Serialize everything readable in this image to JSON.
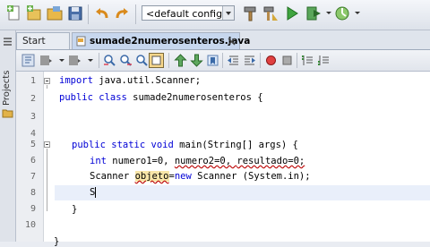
{
  "toolbar": {
    "config_value": "<default config>"
  },
  "sidebar": {
    "projects_label": "Projects"
  },
  "tabs": [
    {
      "label": "Start Page"
    },
    {
      "label": "sumade2numerosenteros.java"
    }
  ],
  "editor": {
    "line_numbers": [
      "1",
      "2",
      "3",
      "4",
      "5",
      "6",
      "7",
      "8",
      "9",
      "10"
    ],
    "lines": {
      "l1_kw": "import",
      "l1_rest": " java.util.Scanner;",
      "l2_kw": "public class",
      "l2_rest": " sumade2numerosenteros {",
      "l5_kw": "public static void",
      "l5_rest": " main(String[] args) {",
      "l6_kw": "int",
      "l6_a": " numero1=0, ",
      "l6_b": "numero2=0, ",
      "l6_c": "resultado=0;",
      "l7_a": "Scanner ",
      "l7_obj": "objeto",
      "l7_eq": "=",
      "l7_new": "new",
      "l7_rest": " Scanner (System.in);",
      "l8": "S",
      "l9": "}",
      "l11": "}"
    }
  },
  "colors": {
    "keyword": "#0000d6",
    "current_line": "#e9effa",
    "error_underline": "#b00"
  }
}
